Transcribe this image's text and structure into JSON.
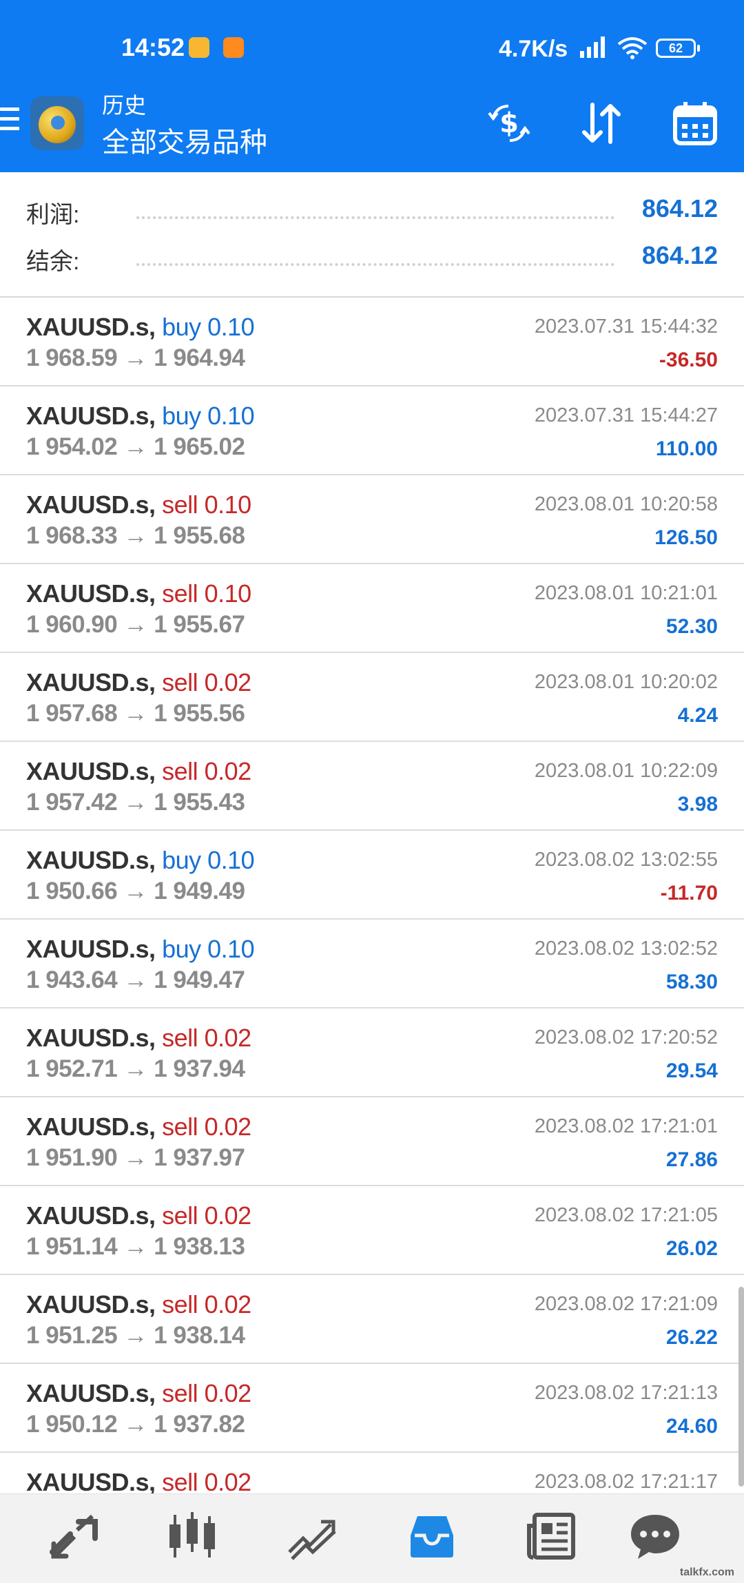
{
  "status_bar": {
    "time": "14:52",
    "network_speed": "4.7K/s",
    "battery": "62"
  },
  "app_bar": {
    "subtitle": "历史",
    "title": "全部交易品种",
    "icons": [
      "menu-icon",
      "currency-exchange-icon",
      "sort-icon",
      "calendar-icon"
    ]
  },
  "summary": {
    "profit_label": "利润:",
    "profit_value": "864.12",
    "balance_label": "结余:",
    "balance_value": "864.12"
  },
  "trades": [
    {
      "symbol": "XAUUSD.s",
      "side": "buy",
      "volume": "0.10",
      "open": "1 968.59",
      "close": "1 964.94",
      "time": "2023.07.31 15:44:32",
      "profit": "-36.50"
    },
    {
      "symbol": "XAUUSD.s",
      "side": "buy",
      "volume": "0.10",
      "open": "1 954.02",
      "close": "1 965.02",
      "time": "2023.07.31 15:44:27",
      "profit": "110.00"
    },
    {
      "symbol": "XAUUSD.s",
      "side": "sell",
      "volume": "0.10",
      "open": "1 968.33",
      "close": "1 955.68",
      "time": "2023.08.01 10:20:58",
      "profit": "126.50"
    },
    {
      "symbol": "XAUUSD.s",
      "side": "sell",
      "volume": "0.10",
      "open": "1 960.90",
      "close": "1 955.67",
      "time": "2023.08.01 10:21:01",
      "profit": "52.30"
    },
    {
      "symbol": "XAUUSD.s",
      "side": "sell",
      "volume": "0.02",
      "open": "1 957.68",
      "close": "1 955.56",
      "time": "2023.08.01 10:20:02",
      "profit": "4.24"
    },
    {
      "symbol": "XAUUSD.s",
      "side": "sell",
      "volume": "0.02",
      "open": "1 957.42",
      "close": "1 955.43",
      "time": "2023.08.01 10:22:09",
      "profit": "3.98"
    },
    {
      "symbol": "XAUUSD.s",
      "side": "buy",
      "volume": "0.10",
      "open": "1 950.66",
      "close": "1 949.49",
      "time": "2023.08.02 13:02:55",
      "profit": "-11.70"
    },
    {
      "symbol": "XAUUSD.s",
      "side": "buy",
      "volume": "0.10",
      "open": "1 943.64",
      "close": "1 949.47",
      "time": "2023.08.02 13:02:52",
      "profit": "58.30"
    },
    {
      "symbol": "XAUUSD.s",
      "side": "sell",
      "volume": "0.02",
      "open": "1 952.71",
      "close": "1 937.94",
      "time": "2023.08.02 17:20:52",
      "profit": "29.54"
    },
    {
      "symbol": "XAUUSD.s",
      "side": "sell",
      "volume": "0.02",
      "open": "1 951.90",
      "close": "1 937.97",
      "time": "2023.08.02 17:21:01",
      "profit": "27.86"
    },
    {
      "symbol": "XAUUSD.s",
      "side": "sell",
      "volume": "0.02",
      "open": "1 951.14",
      "close": "1 938.13",
      "time": "2023.08.02 17:21:05",
      "profit": "26.02"
    },
    {
      "symbol": "XAUUSD.s",
      "side": "sell",
      "volume": "0.02",
      "open": "1 951.25",
      "close": "1 938.14",
      "time": "2023.08.02 17:21:09",
      "profit": "26.22"
    },
    {
      "symbol": "XAUUSD.s",
      "side": "sell",
      "volume": "0.02",
      "open": "1 950.12",
      "close": "1 937.82",
      "time": "2023.08.02 17:21:13",
      "profit": "24.60"
    },
    {
      "symbol": "XAUUSD.s",
      "side": "sell",
      "volume": "0.02",
      "open": "",
      "close": "",
      "time": "2023.08.02 17:21:17",
      "profit": ""
    }
  ],
  "bottom_nav": {
    "items": [
      "quotes-icon",
      "chart-candles-icon",
      "trade-icon",
      "history-inbox-icon",
      "news-icon",
      "chat-icon"
    ],
    "active_index": 3,
    "active_color": "#1e88e5",
    "inactive_color": "#555555"
  },
  "colors": {
    "header": "#0f7bf2",
    "buy": "#1670d3",
    "sell": "#c62828",
    "profit_positive": "#1670d3",
    "profit_negative": "#c62828"
  },
  "watermark": "talkfx.com"
}
